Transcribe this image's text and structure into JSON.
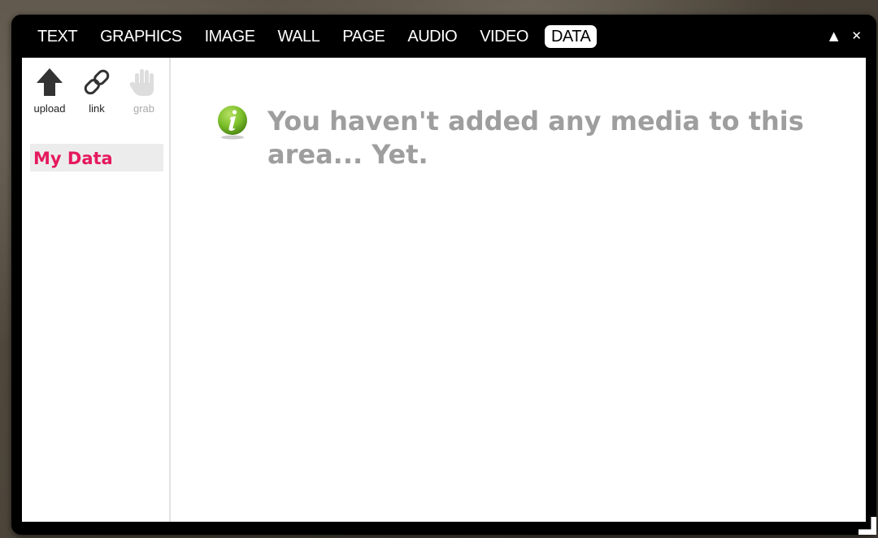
{
  "tabs": [
    {
      "label": "TEXT",
      "active": false
    },
    {
      "label": "GRAPHICS",
      "active": false
    },
    {
      "label": "IMAGE",
      "active": false
    },
    {
      "label": "WALL",
      "active": false
    },
    {
      "label": "PAGE",
      "active": false
    },
    {
      "label": "AUDIO",
      "active": false
    },
    {
      "label": "VIDEO",
      "active": false
    },
    {
      "label": "DATA",
      "active": true
    }
  ],
  "window_controls": {
    "collapse_icon": "triangle-up-icon",
    "close_icon": "close-icon",
    "collapse_glyph": "▲",
    "close_glyph": "✕"
  },
  "sidebar": {
    "tools": [
      {
        "label": "upload",
        "icon": "upload-arrow-icon",
        "enabled": true
      },
      {
        "label": "link",
        "icon": "chain-link-icon",
        "enabled": true
      },
      {
        "label": "grab",
        "icon": "hand-icon",
        "enabled": false
      }
    ],
    "sections": [
      {
        "label": "My Data",
        "selected": true
      }
    ]
  },
  "main": {
    "empty_message": "You haven't added any media to this area... Yet.",
    "info_icon": "info-icon"
  },
  "colors": {
    "accent": "#e5195e",
    "empty_text": "#9e9e9e",
    "info_green": "#7bbf2a"
  }
}
